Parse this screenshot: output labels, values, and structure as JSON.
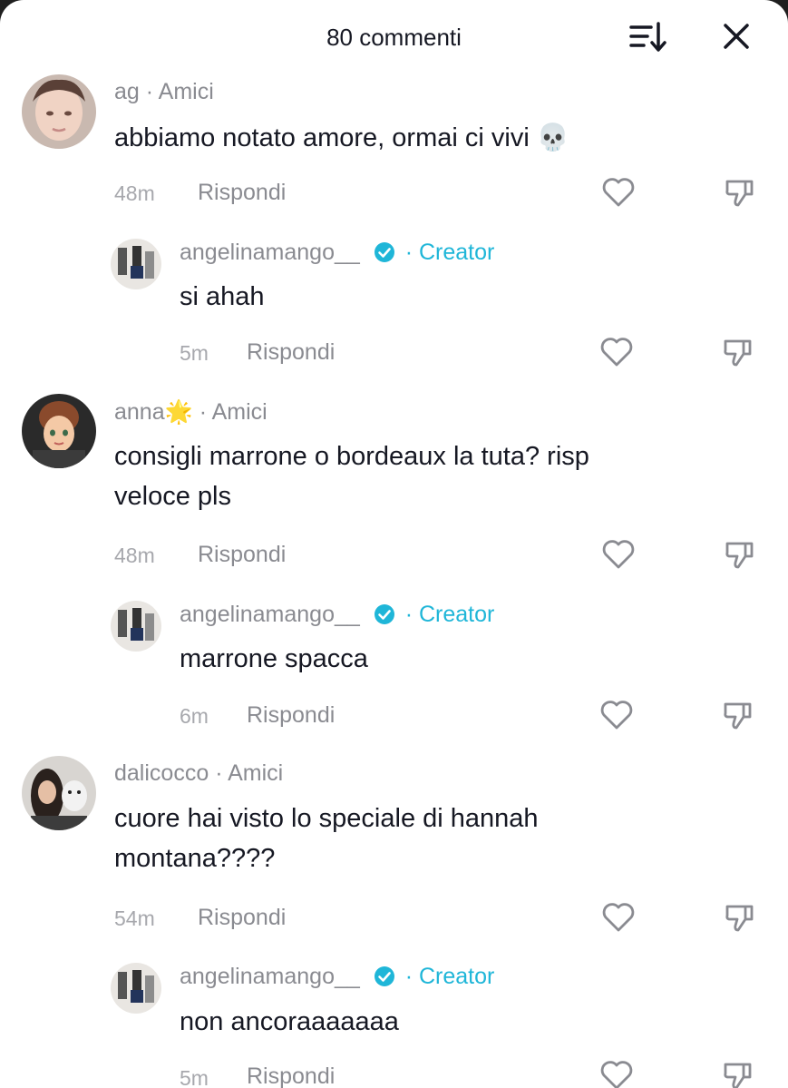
{
  "header": {
    "title": "80 commenti",
    "sort_icon": "sort-icon",
    "close_icon": "close-icon"
  },
  "colors": {
    "creator_accent": "#1fb6d8",
    "text_primary": "#161823",
    "text_secondary": "#8a8b91"
  },
  "comments": [
    {
      "username": "ag",
      "badge": "Amici",
      "text": "abbiamo notato amore, ormai ci vivi",
      "emoji": "💀",
      "time": "48m",
      "reply_label": "Rispondi",
      "reply": {
        "username": "angelinamango__",
        "verified": true,
        "badge": "Creator",
        "text": "si ahah",
        "time": "5m",
        "reply_label": "Rispondi"
      }
    },
    {
      "username": "anna",
      "name_emoji": "🌟",
      "badge": "Amici",
      "text_line1": "consigli marrone o bordeaux la tuta? risp",
      "text_line2": "veloce pls",
      "time": "48m",
      "reply_label": "Rispondi",
      "reply": {
        "username": "angelinamango__",
        "verified": true,
        "badge": "Creator",
        "text": "marrone spacca",
        "time": "6m",
        "reply_label": "Rispondi"
      }
    },
    {
      "username": "dalicocco",
      "badge": "Amici",
      "text_line1": "cuore hai visto lo speciale di hannah",
      "text_line2": "montana????",
      "time": "54m",
      "reply_label": "Rispondi",
      "reply": {
        "username": "angelinamango__",
        "verified": true,
        "badge": "Creator",
        "text": "non ancoraaaaaaa",
        "time": "5m",
        "reply_label": "Rispondi"
      }
    }
  ]
}
